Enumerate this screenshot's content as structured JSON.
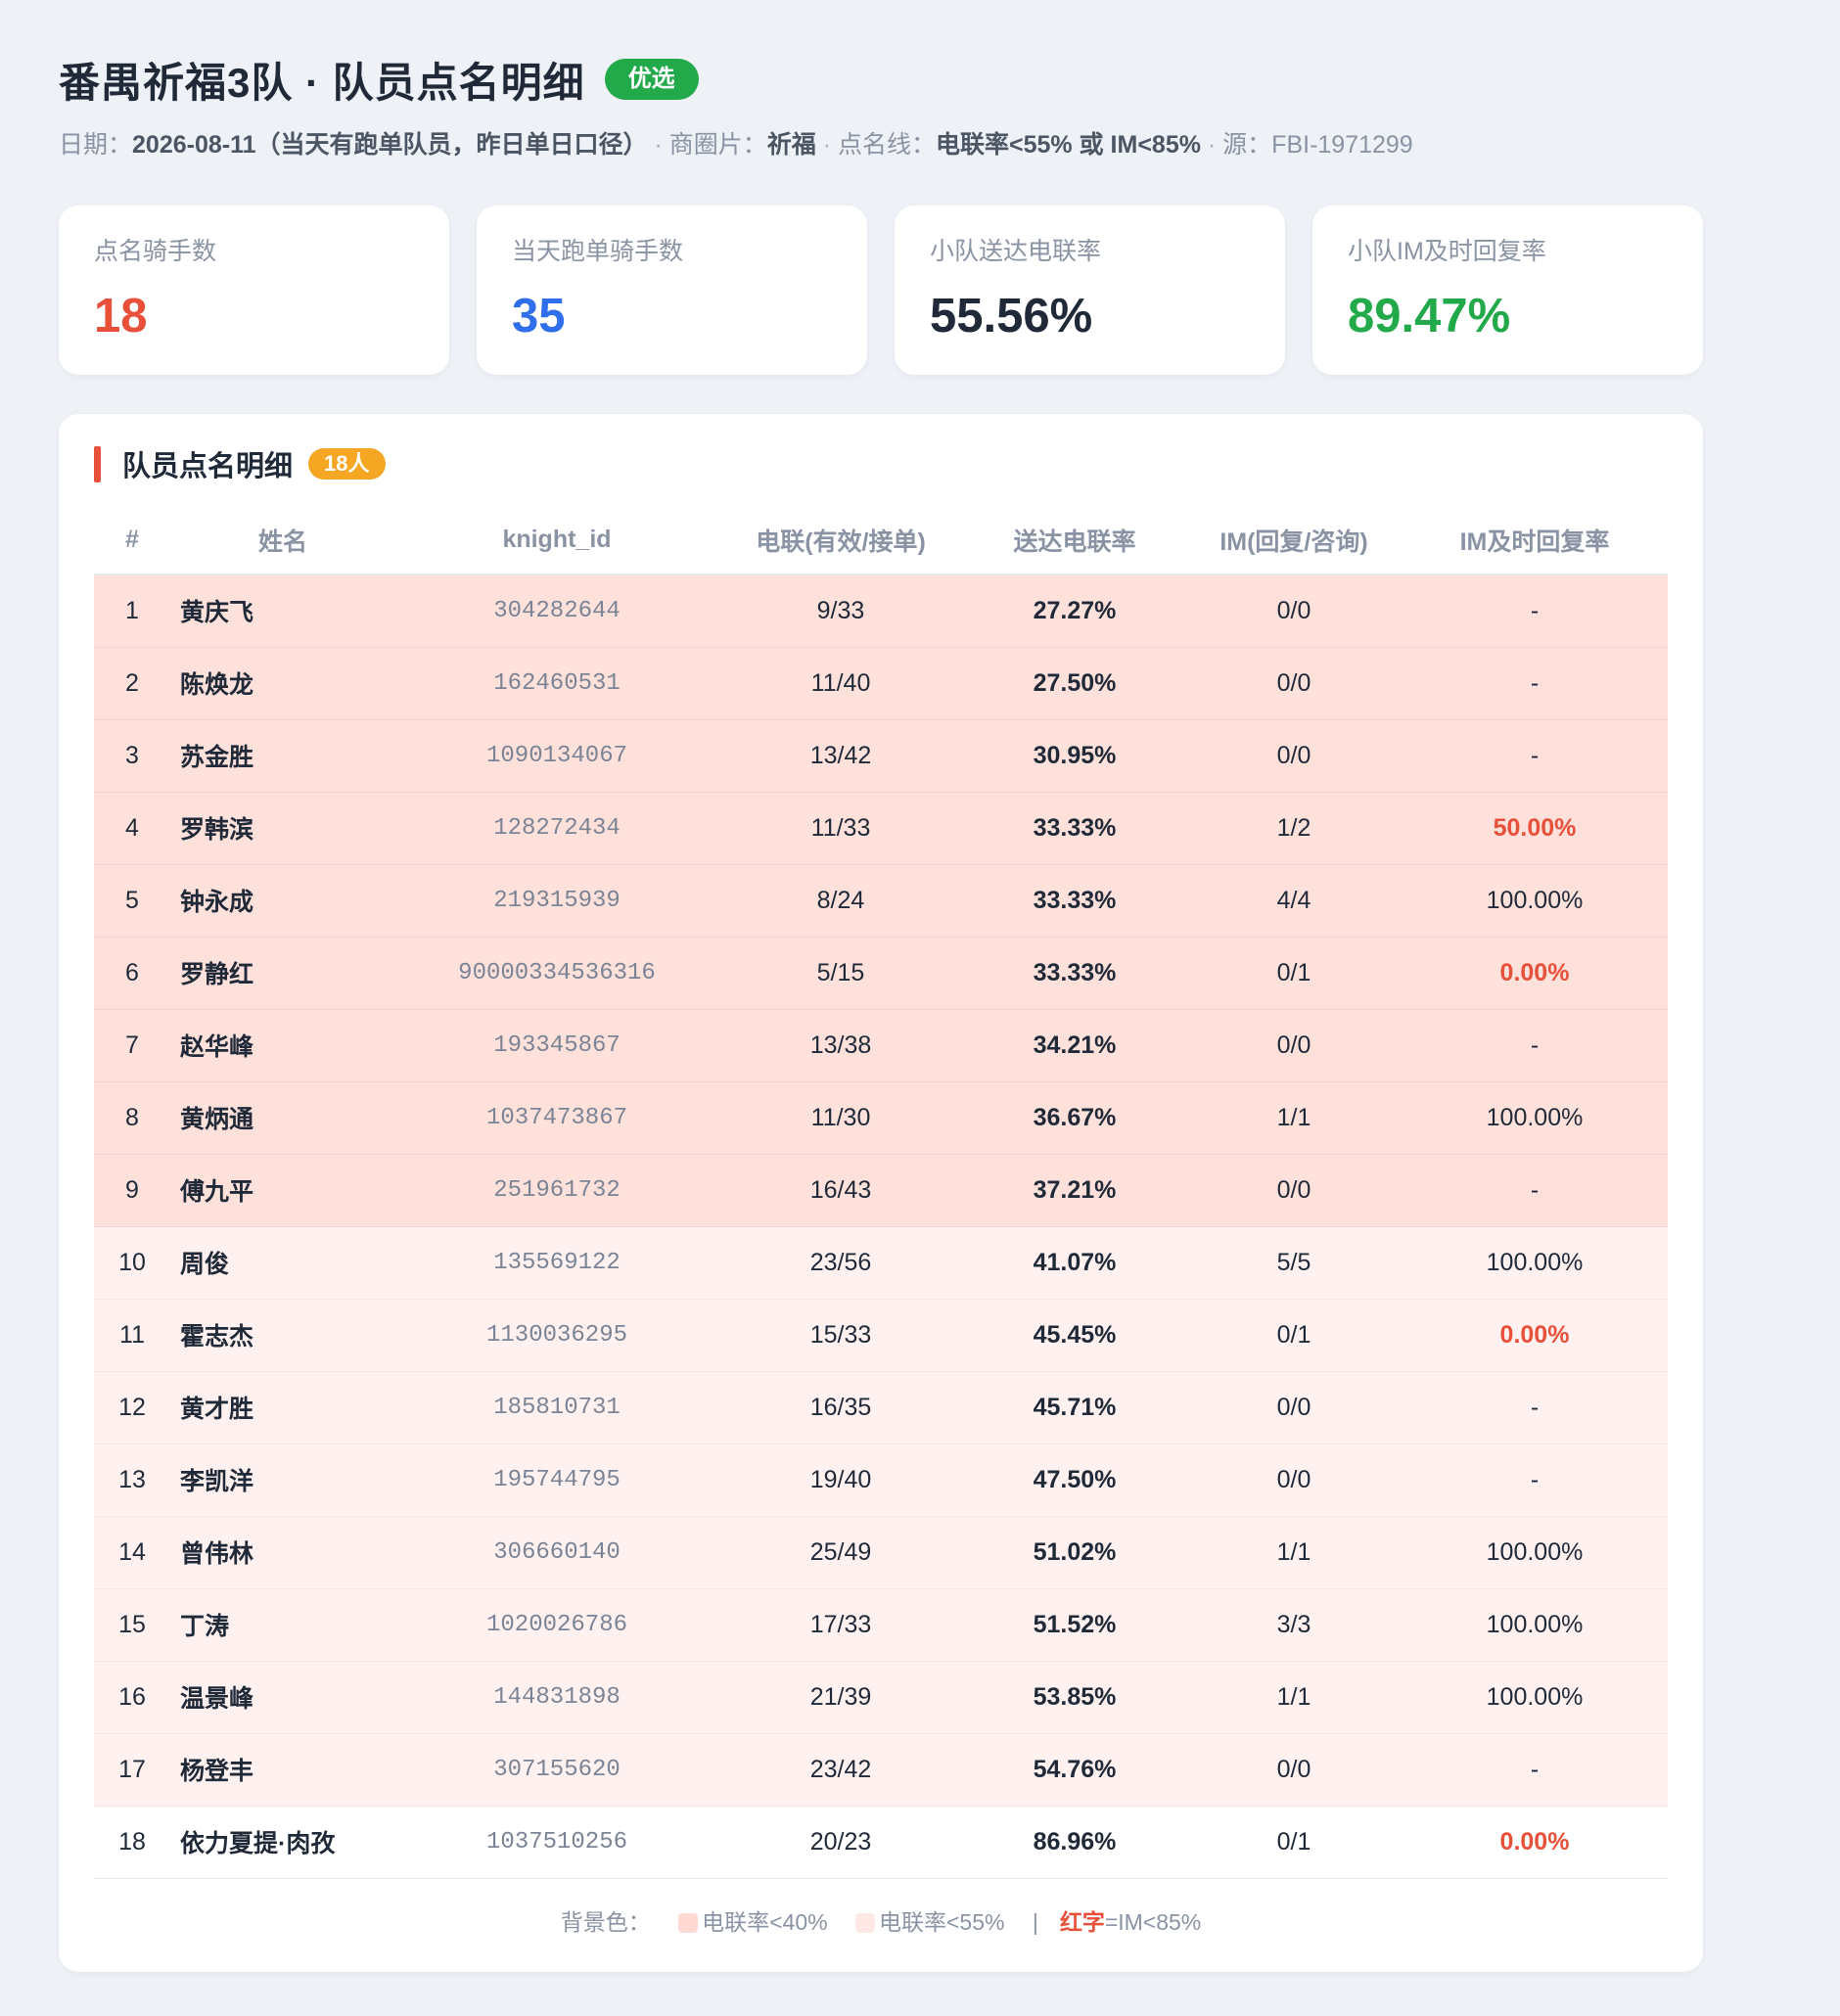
{
  "header": {
    "title": "番禺祈福3队 · 队员点名明细",
    "badge": "优选",
    "date_label": "日期：",
    "date_value": "2026-08-11（当天有跑单队员，昨日单日口径）",
    "sep1": " · ",
    "area_label": "商圈片：",
    "area_value": "祈福",
    "sep2": " · ",
    "rule_label": "点名线：",
    "rule_value": "电联率<55% 或 IM<85%",
    "sep3": " · ",
    "source": "源：FBI-1971299"
  },
  "cards": [
    {
      "label": "点名骑手数",
      "value": "18",
      "color": "#e8503a"
    },
    {
      "label": "当天跑单骑手数",
      "value": "35",
      "color": "#2f6fec"
    },
    {
      "label": "小队送达电联率",
      "value": "55.56%",
      "color": "#1f2937"
    },
    {
      "label": "小队IM及时回复率",
      "value": "89.47%",
      "color": "#22a94a"
    }
  ],
  "panel": {
    "title": "队员点名明细",
    "count_badge": "18人",
    "columns": [
      "#",
      "姓名",
      "knight_id",
      "电联(有效/接单)",
      "送达电联率",
      "IM(回复/咨询)",
      "IM及时回复率"
    ],
    "rows": [
      {
        "no": "1",
        "name": "黄庆飞",
        "id": "304282644",
        "call": "9/33",
        "rate": "27.27%",
        "im": "0/0",
        "im_rate": "-",
        "bg": "red",
        "im_red": false
      },
      {
        "no": "2",
        "name": "陈焕龙",
        "id": "162460531",
        "call": "11/40",
        "rate": "27.50%",
        "im": "0/0",
        "im_rate": "-",
        "bg": "red",
        "im_red": false
      },
      {
        "no": "3",
        "name": "苏金胜",
        "id": "1090134067",
        "call": "13/42",
        "rate": "30.95%",
        "im": "0/0",
        "im_rate": "-",
        "bg": "red",
        "im_red": false
      },
      {
        "no": "4",
        "name": "罗韩滨",
        "id": "128272434",
        "call": "11/33",
        "rate": "33.33%",
        "im": "1/2",
        "im_rate": "50.00%",
        "bg": "red",
        "im_red": true
      },
      {
        "no": "5",
        "name": "钟永成",
        "id": "219315939",
        "call": "8/24",
        "rate": "33.33%",
        "im": "4/4",
        "im_rate": "100.00%",
        "bg": "red",
        "im_red": false
      },
      {
        "no": "6",
        "name": "罗静红",
        "id": "90000334536316",
        "call": "5/15",
        "rate": "33.33%",
        "im": "0/1",
        "im_rate": "0.00%",
        "bg": "red",
        "im_red": true
      },
      {
        "no": "7",
        "name": "赵华峰",
        "id": "193345867",
        "call": "13/38",
        "rate": "34.21%",
        "im": "0/0",
        "im_rate": "-",
        "bg": "red",
        "im_red": false
      },
      {
        "no": "8",
        "name": "黄炳通",
        "id": "1037473867",
        "call": "11/30",
        "rate": "36.67%",
        "im": "1/1",
        "im_rate": "100.00%",
        "bg": "red",
        "im_red": false
      },
      {
        "no": "9",
        "name": "傅九平",
        "id": "251961732",
        "call": "16/43",
        "rate": "37.21%",
        "im": "0/0",
        "im_rate": "-",
        "bg": "red",
        "im_red": false
      },
      {
        "no": "10",
        "name": "周俊",
        "id": "135569122",
        "call": "23/56",
        "rate": "41.07%",
        "im": "5/5",
        "im_rate": "100.00%",
        "bg": "pink",
        "im_red": false
      },
      {
        "no": "11",
        "name": "霍志杰",
        "id": "1130036295",
        "call": "15/33",
        "rate": "45.45%",
        "im": "0/1",
        "im_rate": "0.00%",
        "bg": "pink",
        "im_red": true
      },
      {
        "no": "12",
        "name": "黄才胜",
        "id": "185810731",
        "call": "16/35",
        "rate": "45.71%",
        "im": "0/0",
        "im_rate": "-",
        "bg": "pink",
        "im_red": false
      },
      {
        "no": "13",
        "name": "李凯洋",
        "id": "195744795",
        "call": "19/40",
        "rate": "47.50%",
        "im": "0/0",
        "im_rate": "-",
        "bg": "pink",
        "im_red": false
      },
      {
        "no": "14",
        "name": "曾伟林",
        "id": "306660140",
        "call": "25/49",
        "rate": "51.02%",
        "im": "1/1",
        "im_rate": "100.00%",
        "bg": "pink",
        "im_red": false
      },
      {
        "no": "15",
        "name": "丁涛",
        "id": "1020026786",
        "call": "17/33",
        "rate": "51.52%",
        "im": "3/3",
        "im_rate": "100.00%",
        "bg": "pink",
        "im_red": false
      },
      {
        "no": "16",
        "name": "温景峰",
        "id": "144831898",
        "call": "21/39",
        "rate": "53.85%",
        "im": "1/1",
        "im_rate": "100.00%",
        "bg": "pink",
        "im_red": false
      },
      {
        "no": "17",
        "name": "杨登丰",
        "id": "307155620",
        "call": "23/42",
        "rate": "54.76%",
        "im": "0/0",
        "im_rate": "-",
        "bg": "pink",
        "im_red": false
      },
      {
        "no": "18",
        "name": "依力夏提·肉孜",
        "id": "1037510256",
        "call": "20/23",
        "rate": "86.96%",
        "im": "0/1",
        "im_rate": "0.00%",
        "bg": "plain",
        "im_red": true
      }
    ]
  },
  "legend": {
    "prefix": "背景色：",
    "item1": "电联率<40%",
    "item2": "电联率<55%",
    "pipe": "|",
    "red_text": "红字",
    "red_rule": "=IM<85%"
  }
}
